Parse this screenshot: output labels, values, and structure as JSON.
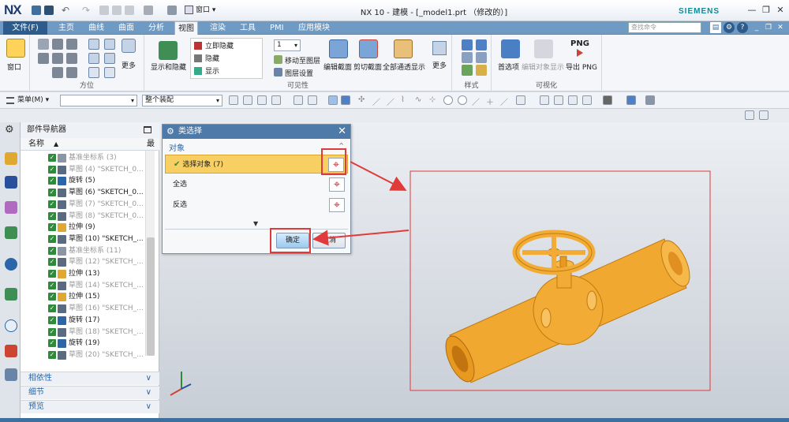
{
  "app": {
    "logo": "NX",
    "title": "NX 10 - 建模 - [_model1.prt （修改的）]",
    "brand": "SIEMENS",
    "window_menu_label": "窗口"
  },
  "tabs": [
    "文件(F)",
    "主页",
    "曲线",
    "曲面",
    "分析",
    "视图",
    "渲染",
    "工具",
    "PMI",
    "应用模块"
  ],
  "active_tab": "视图",
  "command_search_placeholder": "查找命令",
  "ribbon": {
    "window_btn": "窗口",
    "orient_group": "方位",
    "more_btn": "更多",
    "show_hide_btn": "显示和隐藏",
    "immediate_hide": "立即隐藏",
    "hide": "隐藏",
    "show": "显示",
    "layer_value": "1",
    "move_to_layer": "移动至图层",
    "layer_settings": "图层设置",
    "visibility_group": "可见性",
    "edit_section": "编辑截面",
    "clip_section": "剪切截面",
    "full_display": "全部通透显示",
    "more_btn2": "更多",
    "style_group": "样式",
    "preferences": "首选项",
    "edit_obj_display": "编辑对象显示",
    "export_png": "导出 PNG",
    "png_label": "PNG",
    "visualize_group": "可视化"
  },
  "toolbar": {
    "menu_label": "菜单(M)",
    "filter_value": "",
    "assembly_value": "整个装配"
  },
  "navigator": {
    "title": "部件导航器",
    "col_name": "名称",
    "col_latest": "最",
    "rows": [
      {
        "label": "基准坐标系 (3)",
        "dim": true,
        "icon": "datum-csys-icon"
      },
      {
        "label": "草图 (4) \"SKETCH_0...",
        "dim": true,
        "icon": "sketch-icon"
      },
      {
        "label": "旋转 (5)",
        "dim": false,
        "icon": "revolve-icon"
      },
      {
        "label": "草图 (6) \"SKETCH_0...",
        "dim": false,
        "icon": "sketch-icon"
      },
      {
        "label": "草图 (7) \"SKETCH_0...",
        "dim": true,
        "icon": "sketch-icon"
      },
      {
        "label": "草图 (8) \"SKETCH_0...",
        "dim": true,
        "icon": "sketch-icon"
      },
      {
        "label": "拉伸 (9)",
        "dim": false,
        "icon": "extrude-icon"
      },
      {
        "label": "草图 (10) \"SKETCH_...",
        "dim": false,
        "icon": "sketch-icon"
      },
      {
        "label": "基准坐标系 (11)",
        "dim": true,
        "icon": "datum-csys-icon"
      },
      {
        "label": "草图 (12) \"SKETCH_...",
        "dim": true,
        "icon": "sketch-icon"
      },
      {
        "label": "拉伸 (13)",
        "dim": false,
        "icon": "extrude-icon"
      },
      {
        "label": "草图 (14) \"SKETCH_...",
        "dim": true,
        "icon": "sketch-icon"
      },
      {
        "label": "拉伸 (15)",
        "dim": false,
        "icon": "extrude-icon"
      },
      {
        "label": "草图 (16) \"SKETCH_...",
        "dim": true,
        "icon": "sketch-icon"
      },
      {
        "label": "旋转 (17)",
        "dim": false,
        "icon": "revolve-icon"
      },
      {
        "label": "草图 (18) \"SKETCH_...",
        "dim": true,
        "icon": "sketch-icon"
      },
      {
        "label": "旋转 (19)",
        "dim": false,
        "icon": "revolve-icon"
      },
      {
        "label": "草图 (20) \"SKETCH_...",
        "dim": true,
        "icon": "sketch-icon"
      }
    ],
    "panels": [
      "相依性",
      "细节",
      "预览"
    ]
  },
  "dialog": {
    "title": "类选择",
    "section": "对象",
    "select_object": "选择对象 (7)",
    "select_all": "全选",
    "invert": "反选",
    "ok": "确定",
    "cancel": "取消"
  },
  "colors": {
    "tab_bar": "#6e9ac4",
    "file_tab": "#2d5b8c",
    "dialog_title": "#4d7aa8",
    "highlight_row": "#f7cf63",
    "model": "#f0a830",
    "annotation_red": "#e03a3a"
  }
}
